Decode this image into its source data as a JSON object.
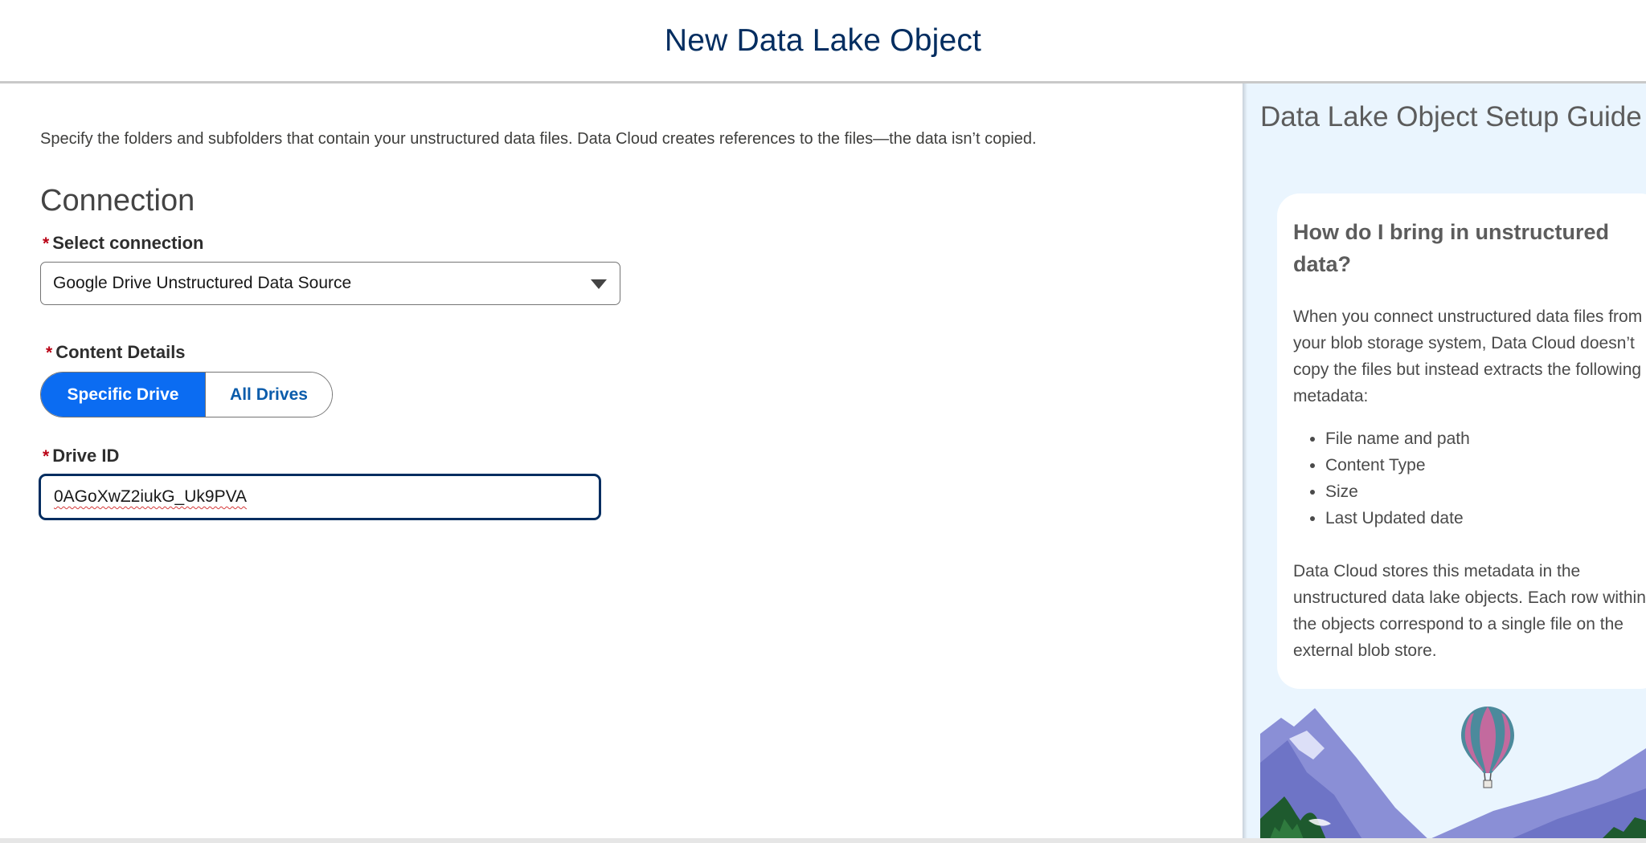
{
  "modal": {
    "title": "New Data Lake Object"
  },
  "main": {
    "intro": "Specify the folders and subfolders that contain your unstructured data files. Data Cloud creates references to the files—the data isn’t copied.",
    "section_title": "Connection",
    "required_marker": "*",
    "select_connection": {
      "label": "Select connection",
      "value": "Google Drive Unstructured Data Source"
    },
    "content_details": {
      "label": "Content Details",
      "options": [
        "Specific Drive",
        "All Drives"
      ],
      "selected": "Specific Drive"
    },
    "drive_id": {
      "label": "Drive ID",
      "value": "0AGoXwZ2iukG_Uk9PVA"
    }
  },
  "guide": {
    "title": "Data Lake Object Setup Guide",
    "card": {
      "heading": "How do I bring in unstructured data?",
      "paragraph1": "When you connect unstructured data files from your blob storage system, Data Cloud doesn’t copy the files but instead extracts the following metadata:",
      "list": [
        "File name and path",
        "Content Type",
        "Size",
        "Last Updated date"
      ],
      "paragraph2": "Data Cloud stores this metadata in the unstructured data lake objects. Each row within the objects correspond to a single file on the external blob store."
    }
  },
  "colors": {
    "brand_blue": "#0b6cf2",
    "title_navy": "#032d60",
    "required_red": "#ba0517",
    "guide_bg": "#eaf5fe"
  }
}
